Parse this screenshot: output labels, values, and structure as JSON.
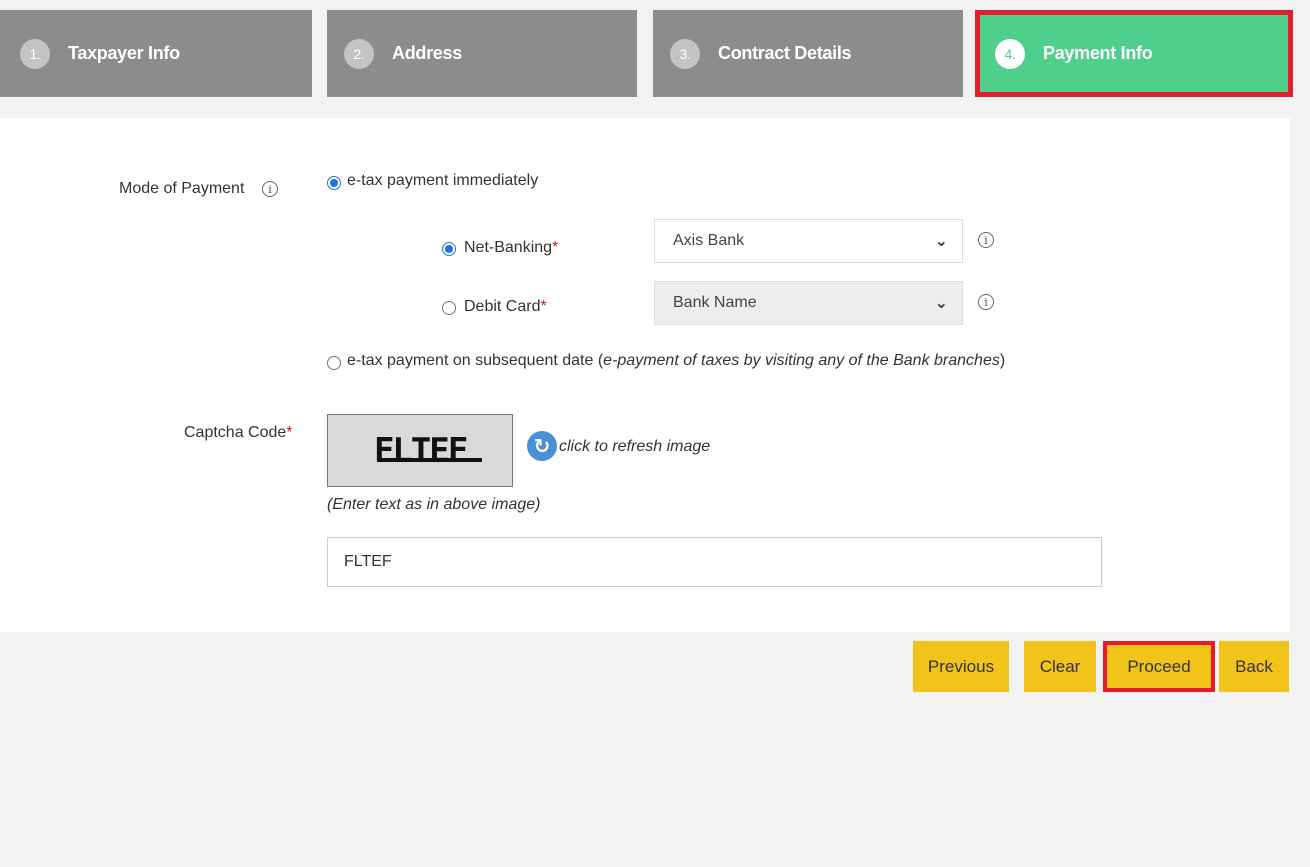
{
  "steps": [
    {
      "num": "1.",
      "label": "Taxpayer Info",
      "active": false
    },
    {
      "num": "2.",
      "label": "Address",
      "active": false
    },
    {
      "num": "3.",
      "label": "Contract Details",
      "active": false
    },
    {
      "num": "4.",
      "label": "Payment Info",
      "active": true
    }
  ],
  "form": {
    "mode_label": "Mode of Payment",
    "immediate_label": "e-tax payment immediately",
    "net_banking_label": "Net-Banking",
    "net_banking_selected": "Axis Bank",
    "debit_card_label": "Debit Card",
    "debit_card_placeholder": "Bank Name",
    "subsequent_label": "e-tax payment on subsequent date (",
    "subsequent_italic": "e-payment of taxes by visiting any of the Bank branches",
    "subsequent_close": ")",
    "captcha_label": "Captcha Code",
    "captcha_image_text": "FLTEF",
    "refresh_label": "click to refresh image",
    "captcha_hint": "(Enter text as in above image)",
    "captcha_value": "FLTEF",
    "required_mark": "*",
    "info_glyph": "i"
  },
  "buttons": {
    "previous": "Previous",
    "clear": "Clear",
    "proceed": "Proceed",
    "back": "Back"
  },
  "colors": {
    "step_inactive": "#8c8c8c",
    "step_active": "#4ecf8c",
    "highlight": "#e21d2d",
    "button": "#f2c319",
    "radio_selected": "#1a73e8"
  }
}
